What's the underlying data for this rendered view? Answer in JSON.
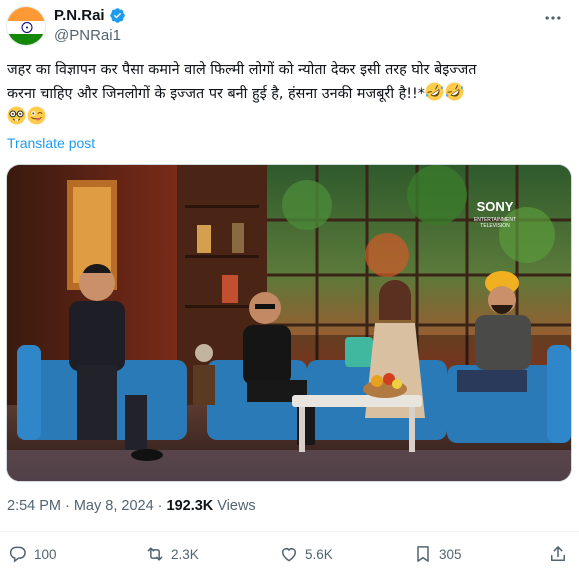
{
  "author": {
    "display_name": "P.N.Rai",
    "handle": "@PNRai1",
    "verified": true,
    "avatar_icon": "india-flag-icon"
  },
  "tweet": {
    "text_line1": "जहर का विज्ञापन कर पैसा कमाने वाले फिल्मी लोगों को न्योता देकर इसी तरह घोर बेइज्जत",
    "text_line2": "करना चाहिए और जिनलोगों के इज्जत पर बनी हुई है, हंसना उनकी मजबूरी है!!*",
    "emojis_line2": [
      "rolling-on-floor-laughing-emoji",
      "rolling-on-floor-laughing-emoji"
    ],
    "emojis_line3": [
      "nerd-face-emoji",
      "winking-face-with-tongue-emoji"
    ],
    "translate_label": "Translate post"
  },
  "media": {
    "logo_brand": "SONY",
    "logo_sub_line1": "ENTERTAINMENT",
    "logo_sub_line2": "TELEVISION"
  },
  "meta": {
    "time": "2:54 PM",
    "separator": "·",
    "date": "May 8, 2024",
    "separator2": "·",
    "views_count": "192.3K",
    "views_label": "Views"
  },
  "actions": {
    "replies": "100",
    "reposts": "2.3K",
    "likes": "5.6K",
    "bookmarks": "305"
  },
  "colors": {
    "accent": "#1d9bf0",
    "text_primary": "#0f1419",
    "text_secondary": "#536471"
  }
}
